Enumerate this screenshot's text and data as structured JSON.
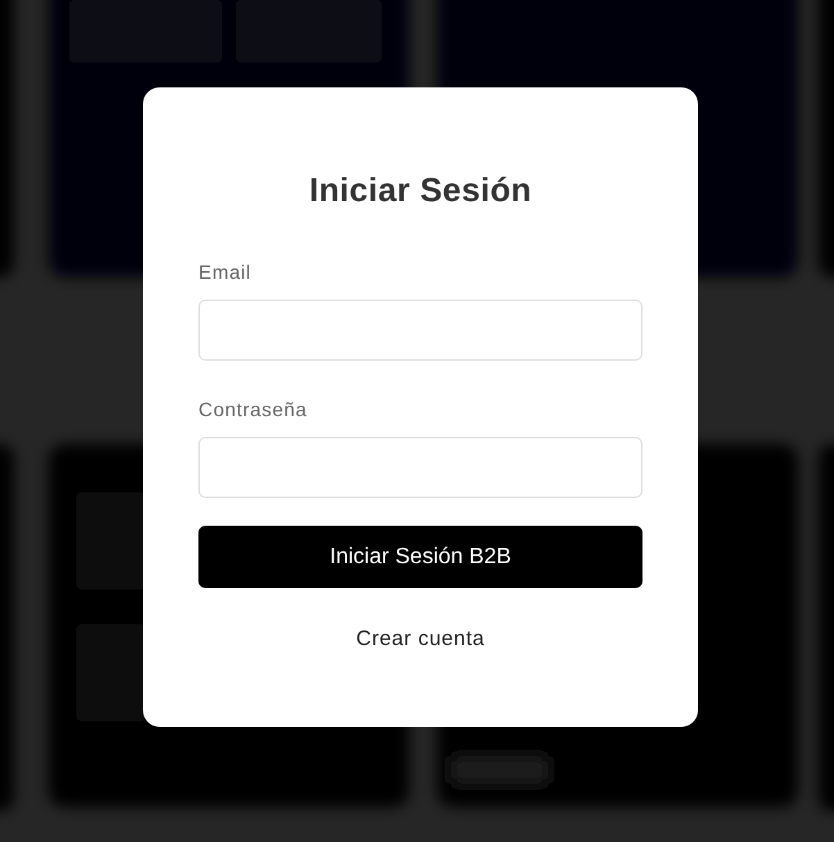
{
  "dialog": {
    "title": "Iniciar Sesión",
    "fields": [
      {
        "label": "Email"
      },
      {
        "label": "Contraseña"
      }
    ],
    "submit_button": "Iniciar Sesión B2B",
    "link": "Crear cuenta"
  }
}
